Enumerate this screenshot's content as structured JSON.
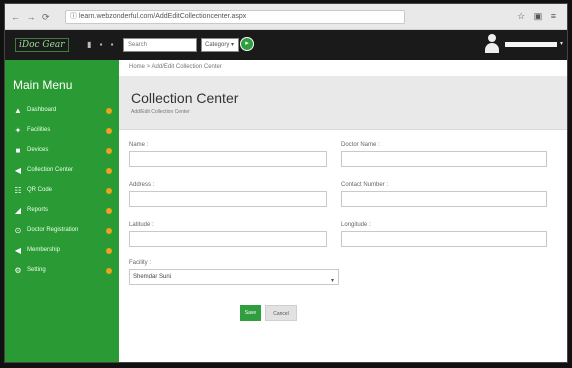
{
  "browser": {
    "url": "ⓘ learn.webzonderful.com/AddEditCollectioncenter.aspx",
    "nav_icons": "← → ⟳",
    "tool_icons": "☆ ▣ ≡"
  },
  "topbar": {
    "logo": "iDoc Gear",
    "icons": "▮ ▪ ▪",
    "search_placeholder": "Search",
    "category": "Category ▾",
    "go": "▸"
  },
  "sidebar": {
    "title": "Main Menu",
    "items": [
      {
        "label": "Dashboard",
        "icon": "▲",
        "icon_name": "home-icon"
      },
      {
        "label": "Facilities",
        "icon": "✦",
        "icon_name": "users-icon"
      },
      {
        "label": "Devices",
        "icon": "■",
        "icon_name": "device-icon"
      },
      {
        "label": "Collection Center",
        "icon": "◀",
        "icon_name": "send-icon"
      },
      {
        "label": "QR Code",
        "icon": "☷",
        "icon_name": "qr-code-icon"
      },
      {
        "label": "Reports",
        "icon": "◢",
        "icon_name": "chart-icon"
      },
      {
        "label": "Doctor Registration",
        "icon": "⊙",
        "icon_name": "doctor-icon"
      },
      {
        "label": "Membership",
        "icon": "◀",
        "icon_name": "membership-icon"
      },
      {
        "label": "Setting",
        "icon": "⚙",
        "icon_name": "gear-icon"
      }
    ],
    "badge_color": "#f0a020"
  },
  "content": {
    "breadcrumb": "Home > Add/Edit Collection Center",
    "title": "Collection Center",
    "subtitle": "Add/Edit Collection Center",
    "fields": {
      "name_label": "Name :",
      "name_value": "",
      "doctor_label": "Doctor Name :",
      "doctor_value": "",
      "address_label": "Address :",
      "address_value": "",
      "contact_label": "Contact Number :",
      "contact_value": "",
      "latitude_label": "Latitude :",
      "latitude_value": "",
      "longitude_label": "Longitude :",
      "longitude_value": "",
      "facility_label": "Facility :",
      "facility_value": "Shemdar Suni"
    },
    "save_label": "Save",
    "cancel_label": "Cancel"
  },
  "colors": {
    "sidebar": "#2a9a34",
    "accent": "#2e9e3e",
    "topbar": "#1a1a1a"
  }
}
